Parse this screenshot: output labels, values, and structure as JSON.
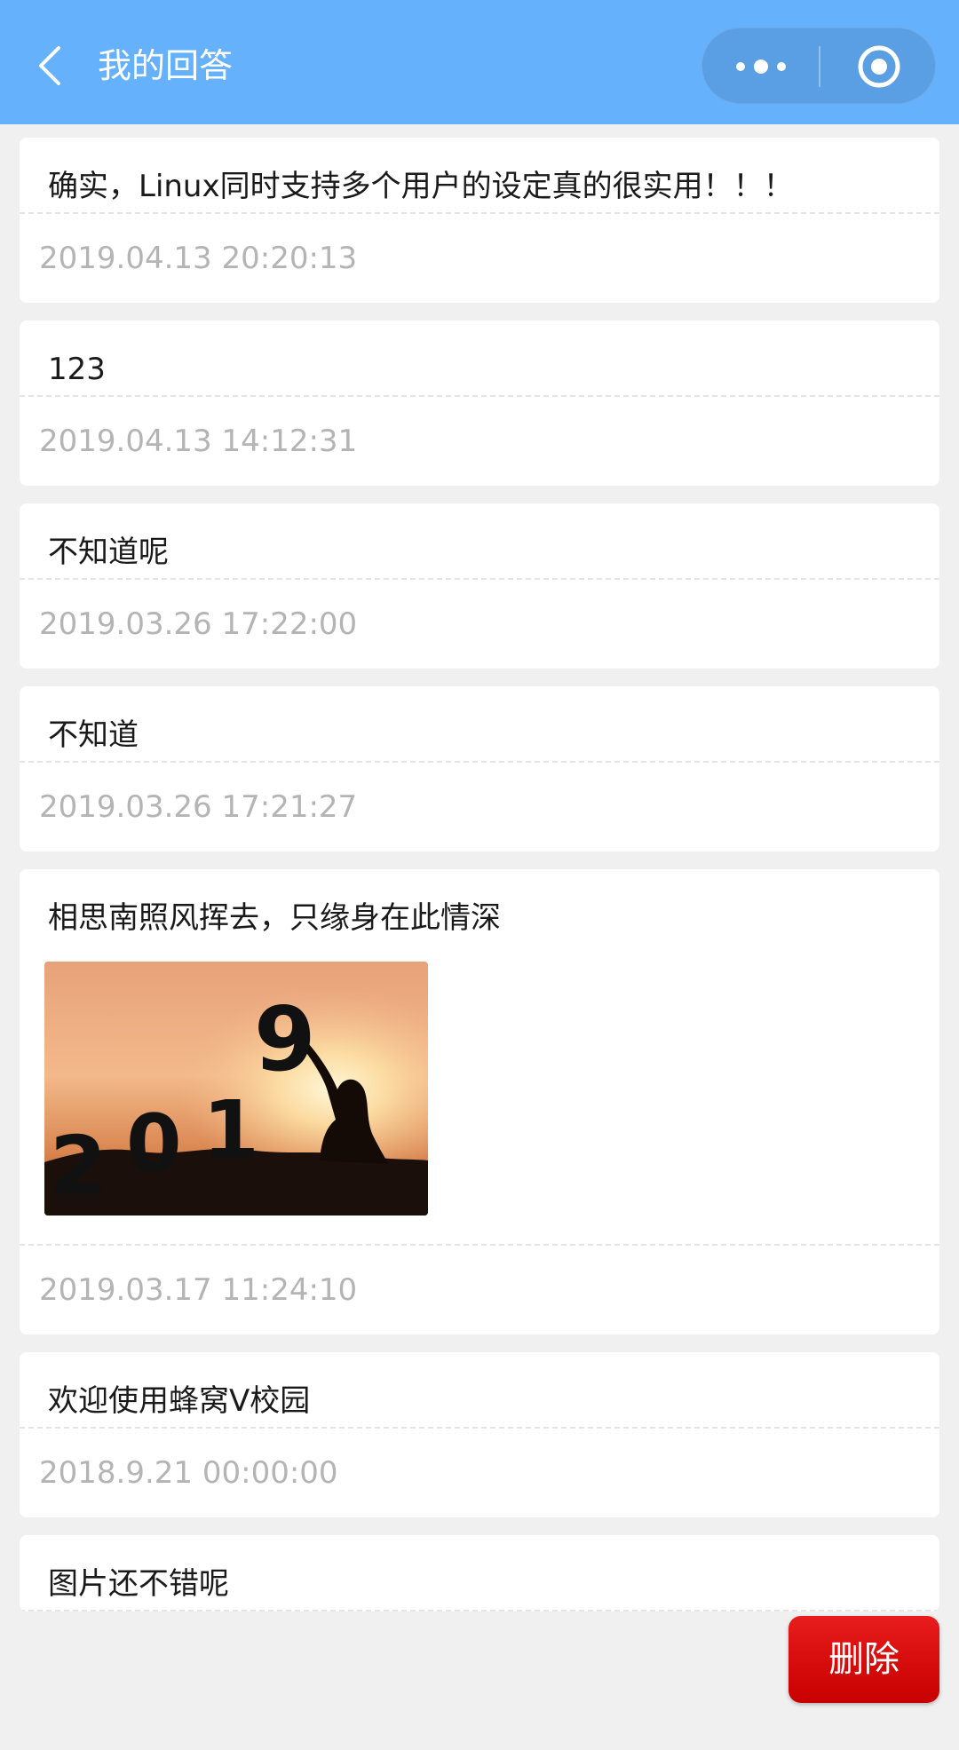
{
  "nav": {
    "title": "我的回答",
    "background": "#66b1fc",
    "icons": {
      "back": "chevron-left-icon",
      "more": "more-dots-icon",
      "close": "target-close-icon"
    }
  },
  "answers": [
    {
      "content": "确实，Linux同时支持多个用户的设定真的很实用！！！",
      "time": "2019.04.13 20:20:13"
    },
    {
      "content": "123",
      "time": "2019.04.13 14:12:31"
    },
    {
      "content": "不知道呢",
      "time": "2019.03.26 17:22:00"
    },
    {
      "content": "不知道",
      "time": "2019.03.26 17:21:27"
    },
    {
      "content": "相思南照风挥去，只缘身在此情深",
      "time": "2019.03.17 11:24:10",
      "image_text": "2019"
    },
    {
      "content": "欢迎使用蜂窝V校园",
      "time": "2018.9.21 00:00:00"
    },
    {
      "content": "图片还不错呢"
    }
  ],
  "delete_button": {
    "label": "删除",
    "color": "#d60a0a"
  }
}
